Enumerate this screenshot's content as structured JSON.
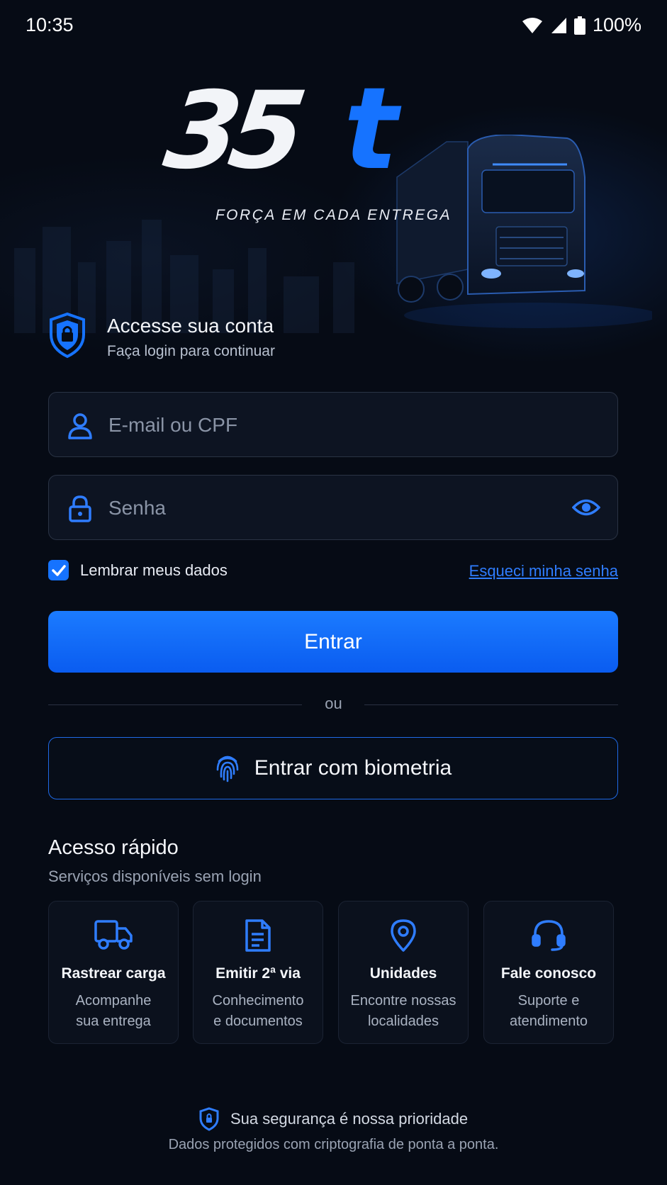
{
  "status_bar": {
    "time": "10:35",
    "battery": "100%"
  },
  "brand": {
    "logo_number": "35",
    "logo_letter": "t",
    "tagline": "FORÇA EM CADA ENTREGA"
  },
  "login": {
    "title": "Accesse sua conta",
    "subtitle": "Faça login para continuar",
    "email_placeholder": "E-mail ou CPF",
    "password_placeholder": "Senha",
    "remember_label": "Lembrar meus dados",
    "remember_checked": true,
    "forgot_label": "Esqueci minha senha",
    "submit_label": "Entrar",
    "or_label": "ou",
    "biometric_label": "Entrar com biometria"
  },
  "quick_access": {
    "title": "Acesso rápido",
    "subtitle": "Serviços disponíveis sem login",
    "cards": [
      {
        "icon": "truck-icon",
        "title": "Rastrear carga",
        "line1": "Acompanhe",
        "line2": "sua entrega"
      },
      {
        "icon": "document-icon",
        "title": "Emitir 2ª via",
        "line1": "Conhecimento",
        "line2": "e documentos"
      },
      {
        "icon": "location-pin-icon",
        "title": "Unidades",
        "line1": "Encontre nossas",
        "line2": "localidades"
      },
      {
        "icon": "headset-icon",
        "title": "Fale conosco",
        "line1": "Suporte e",
        "line2": "atendimento"
      }
    ]
  },
  "footer": {
    "security_title": "Sua segurança é nossa prioridade",
    "security_text": "Dados protegidos com criptografia de ponta a ponta."
  },
  "colors": {
    "accent": "#1673ff",
    "background": "#060b15",
    "field_bg": "#0d1422"
  }
}
